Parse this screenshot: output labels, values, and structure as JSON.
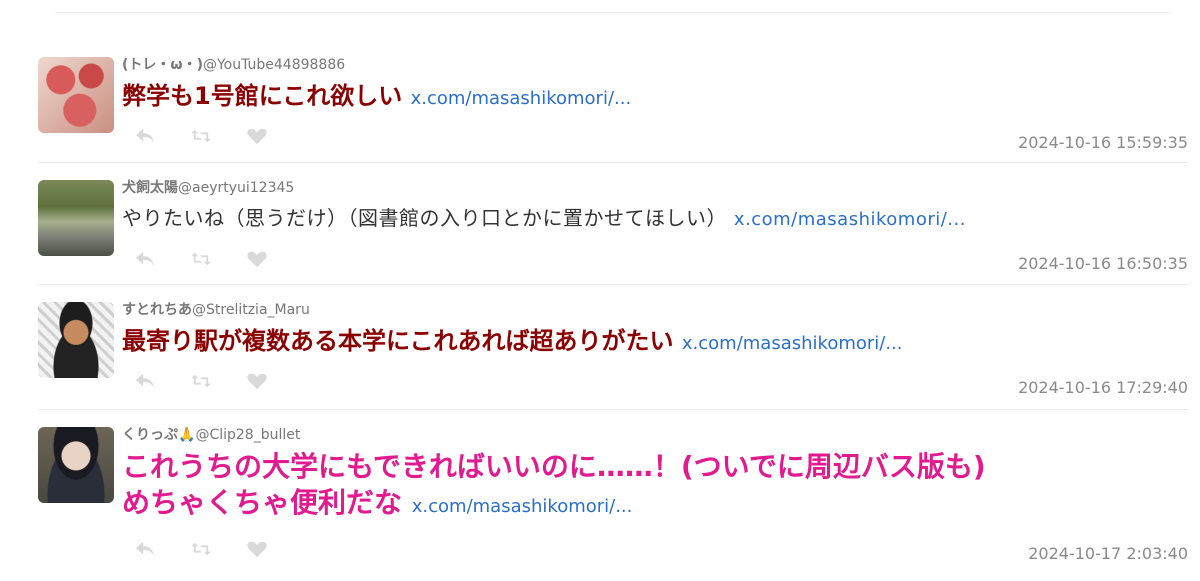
{
  "tweets": [
    {
      "display_name": "(トレ・ω・)",
      "handle": "@YouTube44898886",
      "text": "弊学も1号館にこれ欲しい",
      "link": "x.com/masashikomori/...",
      "timestamp": "2024-10-16 15:59:35",
      "style": "big"
    },
    {
      "display_name": "犬飼太陽",
      "handle": "@aeyrtyui12345",
      "text": "やりたいね（思うだけ）（図書館の入り口とかに置かせてほしい）",
      "link": "x.com/masashikomori/...",
      "timestamp": "2024-10-16 16:50:35",
      "style": "normal"
    },
    {
      "display_name": "すとれちあ",
      "handle": "@Strelitzia_Maru",
      "text": "最寄り駅が複数ある本学にこれあれば超ありがたい",
      "link": "x.com/masashikomori/...",
      "timestamp": "2024-10-16 17:29:40",
      "style": "big"
    },
    {
      "display_name": "くりっぷ🙏",
      "handle": "@Clip28_bullet",
      "text_line1": "これうちの大学にもできればいいのに……！(ついでに周辺バス版も)",
      "text_line2": "めちゃくちゃ便利だな",
      "link": "x.com/masashikomori/...",
      "timestamp": "2024-10-17 2:03:40",
      "style": "pink"
    }
  ],
  "colors": {
    "big_text": "#8b0000",
    "pink_text": "#e21a8f",
    "link": "#2a6fc9",
    "meta": "#8a8a8a"
  },
  "icons": [
    "reply-icon",
    "retweet-icon",
    "like-icon"
  ]
}
